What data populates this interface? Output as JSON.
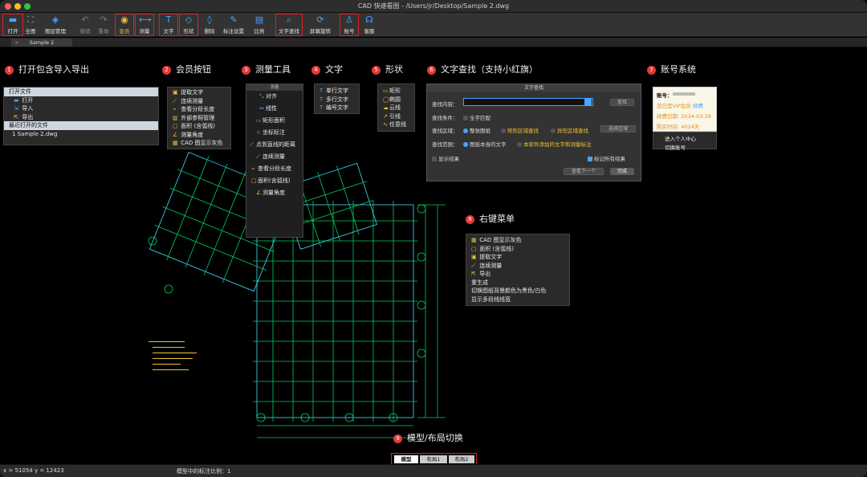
{
  "window": {
    "title": "CAD 快速看图 - /Users/jr/Desktop/Sample 2.dwg"
  },
  "toolbar": {
    "items": [
      {
        "label": "打开",
        "icon": "folder-icon"
      },
      {
        "label": "全图",
        "icon": "fit-view-icon"
      },
      {
        "label": "图层管理",
        "icon": "layers-icon"
      },
      {
        "label": "撤销",
        "icon": "undo-icon"
      },
      {
        "label": "重做",
        "icon": "redo-icon"
      },
      {
        "label": "会员",
        "icon": "vip-icon"
      },
      {
        "label": "测量",
        "icon": "measure-icon"
      },
      {
        "label": "文字",
        "icon": "text-icon"
      },
      {
        "label": "形状",
        "icon": "shape-icon"
      },
      {
        "label": "删除",
        "icon": "eraser-icon"
      },
      {
        "label": "标注设置",
        "icon": "annotation-settings-icon"
      },
      {
        "label": "比例",
        "icon": "scale-icon"
      },
      {
        "label": "文字查找",
        "icon": "text-search-icon"
      },
      {
        "label": "屏幕旋转",
        "icon": "rotate-screen-icon"
      },
      {
        "label": "账号",
        "icon": "user-icon"
      },
      {
        "label": "客服",
        "icon": "headset-icon"
      }
    ]
  },
  "tabs": {
    "document": "Sample 2"
  },
  "sections": {
    "s1": {
      "num": "1",
      "title": "打开包含导入导出"
    },
    "s2": {
      "num": "2",
      "title": "会员按钮"
    },
    "s3": {
      "num": "3",
      "title": "测量工具"
    },
    "s4": {
      "num": "4",
      "title": "文字"
    },
    "s5": {
      "num": "5",
      "title": "形状"
    },
    "s6": {
      "num": "6",
      "title": "文字查找（支持小红旗）"
    },
    "s7": {
      "num": "7",
      "title": "账号系统"
    },
    "s8": {
      "num": "8",
      "title": "右键菜单"
    },
    "s9": {
      "num": "9",
      "title": "模型/布局切换"
    }
  },
  "open_menu": {
    "header_open": "打开文件",
    "items": [
      "打开",
      "导入",
      "导出"
    ],
    "header_recent": "最近打开的文件",
    "recent": [
      "1 Sample 2.dwg"
    ]
  },
  "vip_menu": {
    "items": [
      "提取文字",
      "连续测量",
      "查看分段长度",
      "外部参照管理",
      "面积 (含弧线)",
      "测量角度",
      "CAD 图显示灰色"
    ]
  },
  "measure_menu": {
    "title": "测量",
    "items": [
      "对齐",
      "线性",
      "矩形面积",
      "坐标标注",
      "点到直线的距离",
      "连续测量",
      "查看分段长度",
      "面积(含弧线)",
      "测量角度"
    ]
  },
  "text_menu": {
    "items": [
      "单行文字",
      "多行文字",
      "编号文字"
    ]
  },
  "shape_menu": {
    "items": [
      "矩形",
      "椭圆",
      "云线",
      "引线",
      "任意线"
    ]
  },
  "find_dialog": {
    "title": "文字查找",
    "content_label": "查找内容：",
    "search_button": "查找",
    "condition_label": "查找条件：",
    "match_all": "全字匹配",
    "area_label": "查找区域：",
    "area_options": [
      "整张图纸",
      "矩形区域查找",
      "异形区域查找"
    ],
    "select_area": "选择区域",
    "range_label": "查找范围：",
    "range_options": [
      "图纸本身的文字",
      "本软件添加的文字和测量标注"
    ],
    "show_results": "显示结果",
    "mark_all": "标记所有结果",
    "prev_next": "查看下一个",
    "done": "完成"
  },
  "account": {
    "label": "账号：",
    "vip_status": "您已是VIP会员",
    "renew": "续费",
    "expire": "续费日期: 2034-03-28",
    "purchase": "购买时间: 4024天",
    "center": "进入个人中心",
    "switch": "切换账号"
  },
  "context_menu": {
    "items": [
      "CAD 图显示灰色",
      "面积 (含弧线)",
      "提取文字",
      "连续测量",
      "导出",
      "重生成",
      "切换图纸背景颜色为黑色/白色",
      "显示多段线线宽"
    ]
  },
  "layout_tabs": [
    "模型",
    "布局1",
    "布局2"
  ],
  "status": {
    "coords": "x = 51054  y = 12423",
    "scale": "模型中的标注比例：1"
  },
  "colors": {
    "accent": "#4aa3ff",
    "highlight": "#e02020",
    "cad_line": "#00ff66",
    "cad_cyan": "#40e0ff"
  }
}
